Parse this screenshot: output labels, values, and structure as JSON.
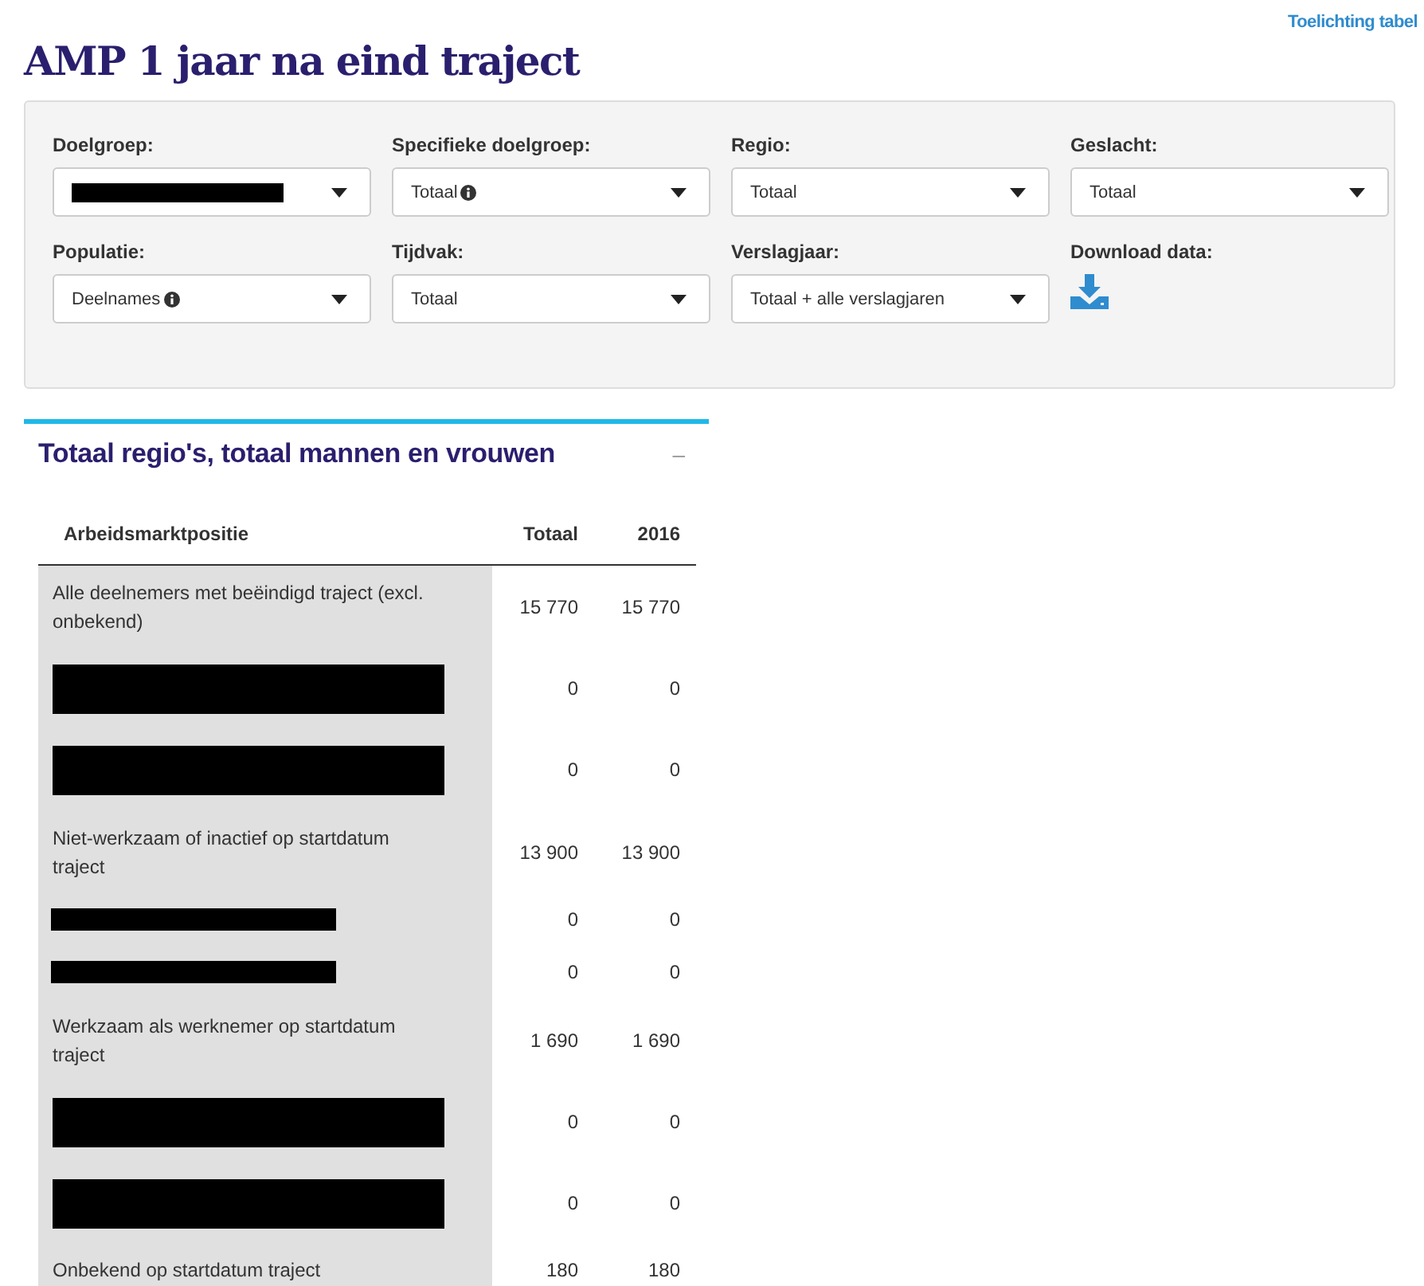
{
  "help_link": "Toelichting tabel",
  "title": "AMP 1 jaar na eind traject",
  "filters": [
    {
      "label": "Doelgroep:",
      "redacted": true
    },
    {
      "label": "Specifieke doelgroep:",
      "value": "Totaal",
      "info": true
    },
    {
      "label": "Regio:",
      "value": "Totaal"
    },
    {
      "label": "Geslacht:",
      "value": "Totaal"
    },
    {
      "label": "Populatie:",
      "value": "Deelnames",
      "info": true
    },
    {
      "label": "Tijdvak:",
      "value": "Totaal"
    },
    {
      "label": "Verslagjaar:",
      "value": "Totaal + alle verslagjaren"
    }
  ],
  "download": {
    "label": "Download data:"
  },
  "section": {
    "title": "Totaal regio's, totaal mannen en vrouwen",
    "collapse": "–",
    "table": {
      "columns": [
        "Arbeidsmarktpositie",
        "Totaal",
        "2016"
      ],
      "rows": [
        {
          "kind": "label",
          "label": "Alle deelnemers met beëindigd traject (excl. onbekend)",
          "values": [
            "15 770",
            "15 770"
          ]
        },
        {
          "kind": "redacted",
          "thin": false,
          "values": [
            "0",
            "0"
          ]
        },
        {
          "kind": "redacted",
          "thin": false,
          "values": [
            "0",
            "0"
          ]
        },
        {
          "kind": "label",
          "label": "Niet-werkzaam of inactief op startdatum traject",
          "values": [
            "13 900",
            "13 900"
          ]
        },
        {
          "kind": "redacted",
          "thin": true,
          "values": [
            "0",
            "0"
          ]
        },
        {
          "kind": "redacted",
          "thin": true,
          "values": [
            "0",
            "0"
          ]
        },
        {
          "kind": "label",
          "label": "Werkzaam als werknemer op startdatum traject",
          "values": [
            "1 690",
            "1 690"
          ]
        },
        {
          "kind": "redacted",
          "thin": false,
          "values": [
            "0",
            "0"
          ]
        },
        {
          "kind": "redacted",
          "thin": false,
          "values": [
            "0",
            "0"
          ]
        },
        {
          "kind": "label",
          "label": "Onbekend op startdatum traject",
          "values": [
            "180",
            "180"
          ]
        }
      ]
    }
  }
}
